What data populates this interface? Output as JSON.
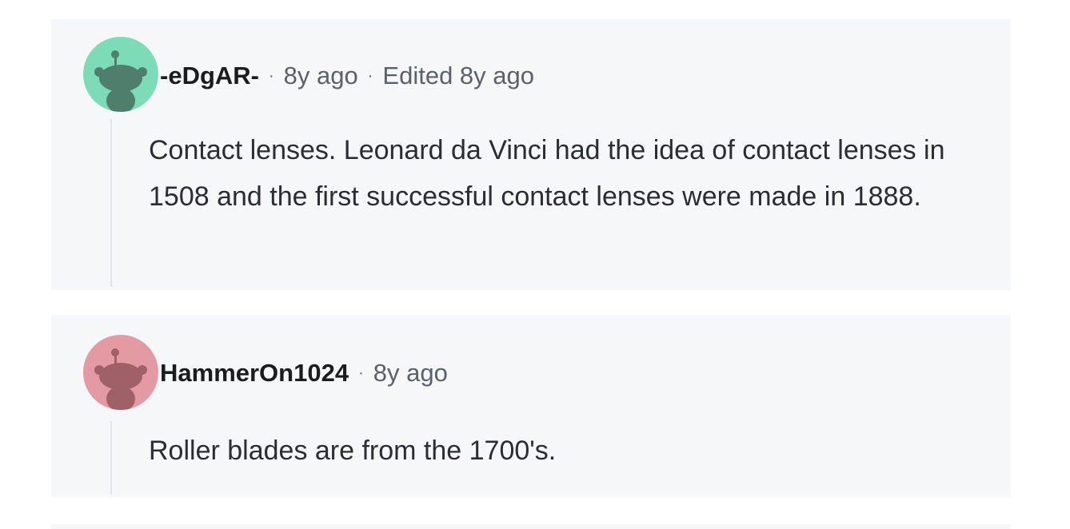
{
  "comments": [
    {
      "username": "-eDgAR-",
      "age": "8y ago",
      "edited": "Edited 8y ago",
      "avatar_color": "#7ddcb7",
      "avatar_figure_color": "#4f7e6c",
      "avatar_icon": "snoo-avatar-icon",
      "body": "Contact lenses. Leonard da Vinci had the idea of contact lenses in 1508 and the first successful contact lenses were made in 1888."
    },
    {
      "username": "HammerOn1024",
      "age": "8y ago",
      "avatar_color": "#e49aa3",
      "avatar_figure_color": "#a06068",
      "avatar_icon": "snoo-avatar-icon",
      "body": "Roller blades are from the 1700's."
    }
  ],
  "separator": "·"
}
